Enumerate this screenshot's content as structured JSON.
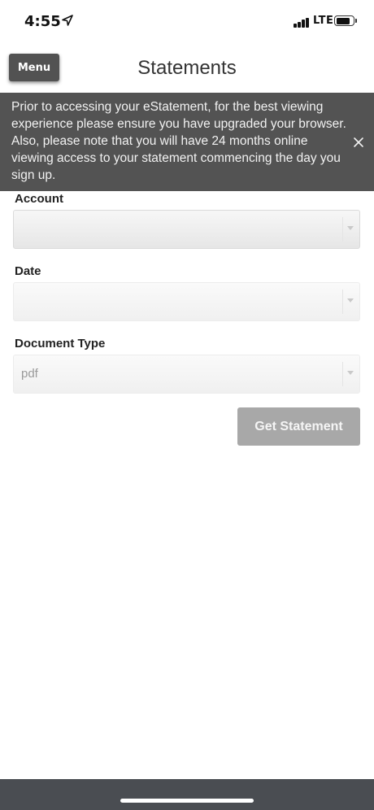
{
  "status_bar": {
    "time": "4:55",
    "network": "LTE"
  },
  "header": {
    "menu_label": "Menu",
    "title": "Statements"
  },
  "notice": {
    "text": "Prior to accessing your eStatement, for the best viewing experience please ensure you have upgraded your browser. Also, please note that you will have 24 months online viewing access to your statement commencing the day you sign up."
  },
  "form": {
    "account": {
      "label": "Account",
      "value": ""
    },
    "date": {
      "label": "Date",
      "value": ""
    },
    "document_type": {
      "label": "Document Type",
      "value": "pdf"
    },
    "submit_label": "Get Statement"
  },
  "icons": {
    "location": "location-arrow-icon",
    "signal": "cellular-signal-icon",
    "battery": "battery-icon",
    "close": "close-icon",
    "dropdown": "chevron-down-icon"
  }
}
